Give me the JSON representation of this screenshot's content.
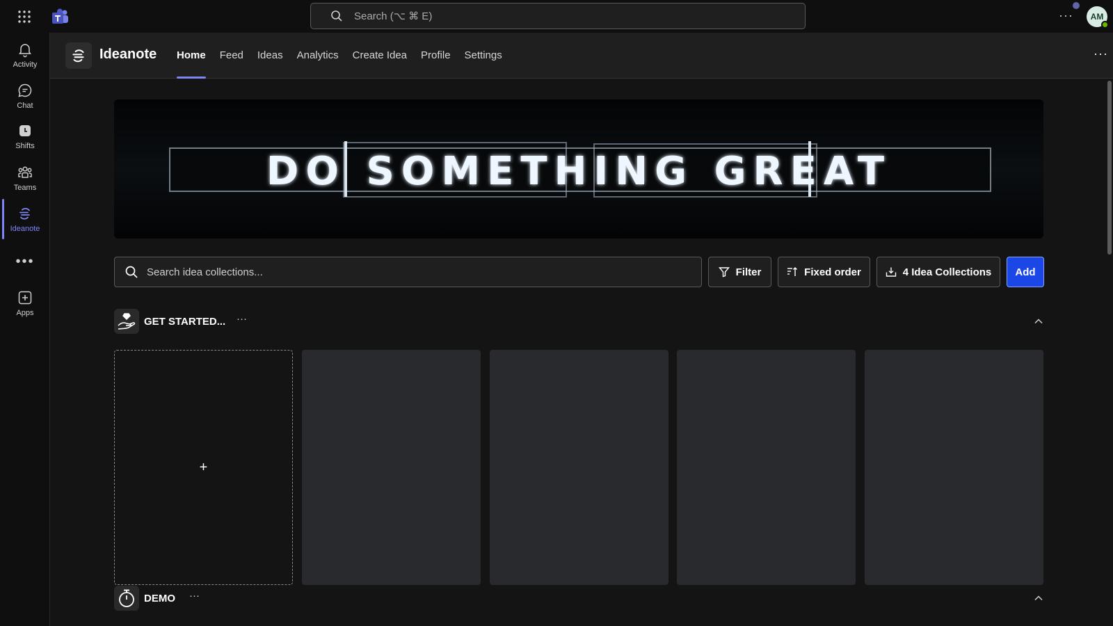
{
  "topbar": {
    "search_placeholder": "Search (⌥ ⌘ E)",
    "avatar_initials": "AM",
    "more_label": "···"
  },
  "rail": {
    "items": [
      {
        "label": "Activity",
        "icon": "bell-icon"
      },
      {
        "label": "Chat",
        "icon": "chat-icon"
      },
      {
        "label": "Shifts",
        "icon": "clock-icon"
      },
      {
        "label": "Teams",
        "icon": "people-icon"
      },
      {
        "label": "Ideanote",
        "icon": "ideanote-icon",
        "active": true
      },
      {
        "label": "Apps",
        "icon": "plus-square-icon"
      }
    ],
    "more_label": "•••"
  },
  "app": {
    "name": "Ideanote",
    "tabs": [
      {
        "label": "Home",
        "active": true
      },
      {
        "label": "Feed"
      },
      {
        "label": "Ideas"
      },
      {
        "label": "Analytics"
      },
      {
        "label": "Create Idea"
      },
      {
        "label": "Profile"
      },
      {
        "label": "Settings"
      }
    ],
    "more_label": "···"
  },
  "banner": {
    "neon_text": "DO SOMETHING GREAT"
  },
  "toolbar": {
    "search_placeholder": "Search idea collections...",
    "filter_label": "Filter",
    "order_label": "Fixed order",
    "collections_label": "4 Idea Collections",
    "add_label": "Add"
  },
  "sections": [
    {
      "title": "GET STARTED...",
      "more": "···",
      "icon": "hand-diamond-icon"
    },
    {
      "title": "DEMO",
      "more": "···",
      "icon": "stopwatch-icon"
    }
  ],
  "cards": {
    "add_symbol": "+"
  },
  "colors": {
    "accent": "#7f85f5",
    "primary_button": "#1a47e5",
    "card_bg": "#292a2e"
  }
}
